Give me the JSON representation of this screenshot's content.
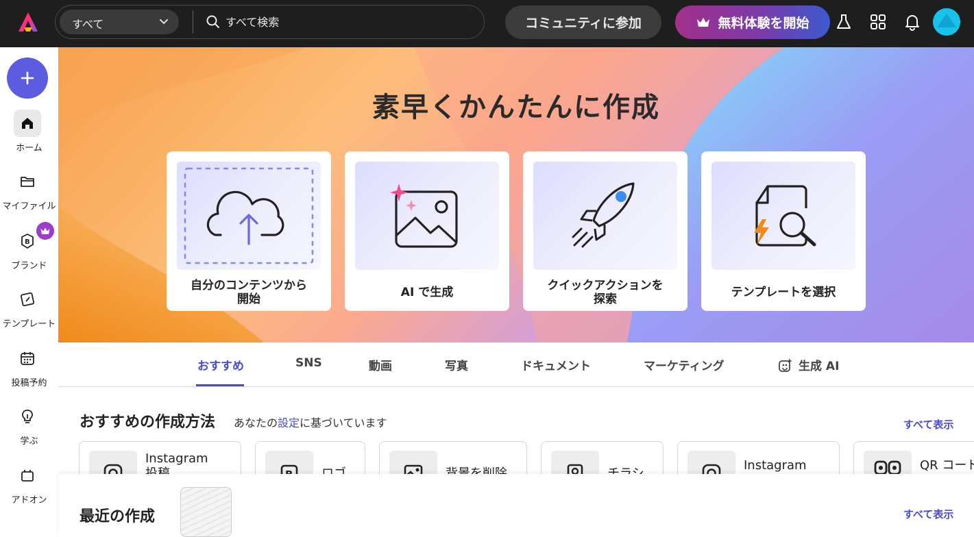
{
  "topbar": {
    "scope_select": "すべて",
    "search_placeholder": "すべて検索",
    "community_button": "コミュニティに参加",
    "trial_button": "無料体験を開始"
  },
  "sidebar": {
    "items": [
      {
        "label": "ホーム",
        "icon": "home-icon"
      },
      {
        "label": "マイファイル",
        "icon": "folder-icon"
      },
      {
        "label": "ブランド",
        "icon": "brand-icon"
      },
      {
        "label": "テンプレート",
        "icon": "template-icon"
      },
      {
        "label": "投稿予約",
        "icon": "calendar-icon"
      },
      {
        "label": "学ぶ",
        "icon": "lightbulb-icon"
      },
      {
        "label": "アドオン",
        "icon": "addon-icon"
      }
    ]
  },
  "hero": {
    "title": "素早くかんたんに作成",
    "cards": [
      {
        "label": "自分のコンテンツから\n開始",
        "icon": "cloud-upload-icon"
      },
      {
        "label": "AI で生成",
        "icon": "ai-image-icon"
      },
      {
        "label": "クイックアクションを\n探索",
        "icon": "rocket-icon"
      },
      {
        "label": "テンプレートを選択",
        "icon": "template-search-icon"
      }
    ]
  },
  "tabs": [
    "おすすめ",
    "SNS",
    "動画",
    "写真",
    "ドキュメント",
    "マーケティング",
    "生成 AI"
  ],
  "recommended": {
    "title": "おすすめの作成方法",
    "subtitle_prefix": "あなたの",
    "subtitle_link": "設定",
    "subtitle_suffix": "に基づいています",
    "see_all": "すべて表示",
    "items": [
      {
        "label": "Instagram\n投稿",
        "icon": "instagram-icon"
      },
      {
        "label": "ロゴ",
        "icon": "logo-icon"
      },
      {
        "label": "背景を削除",
        "icon": "remove-bg-icon"
      },
      {
        "label": "チラシ",
        "icon": "flyer-icon"
      },
      {
        "label": "Instagram",
        "icon": "instagram-icon"
      },
      {
        "label": "QR コード",
        "icon": "qr-icon"
      }
    ]
  },
  "recent": {
    "title": "最近の作成",
    "see_all": "すべて表示"
  },
  "colors": {
    "accent": "#4a4ad0",
    "topbar_bg": "#1e1e1e",
    "create_button": "#5c5ce0"
  }
}
